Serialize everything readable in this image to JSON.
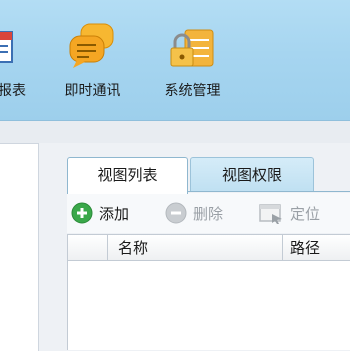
{
  "toolbar_nav": [
    {
      "label": "报表",
      "icon": "report-icon"
    },
    {
      "label": "即时通讯",
      "icon": "chat-bubbles-icon"
    },
    {
      "label": "系统管理",
      "icon": "lock-folder-icon"
    }
  ],
  "tabs": [
    {
      "label": "视图列表",
      "active": true
    },
    {
      "label": "视图权限",
      "active": false
    }
  ],
  "actions": {
    "add": {
      "label": "添加",
      "icon": "add-icon",
      "enabled": true
    },
    "delete": {
      "label": "删除",
      "icon": "delete-icon",
      "enabled": false
    },
    "locate": {
      "label": "定位",
      "icon": "locate-icon",
      "enabled": false
    }
  },
  "grid": {
    "columns": [
      "名称",
      "路径"
    ]
  },
  "colors": {
    "ribbon": "#a6d5f0",
    "add_green": "#3aa84a",
    "disabled_gray": "#9aa0a6"
  }
}
